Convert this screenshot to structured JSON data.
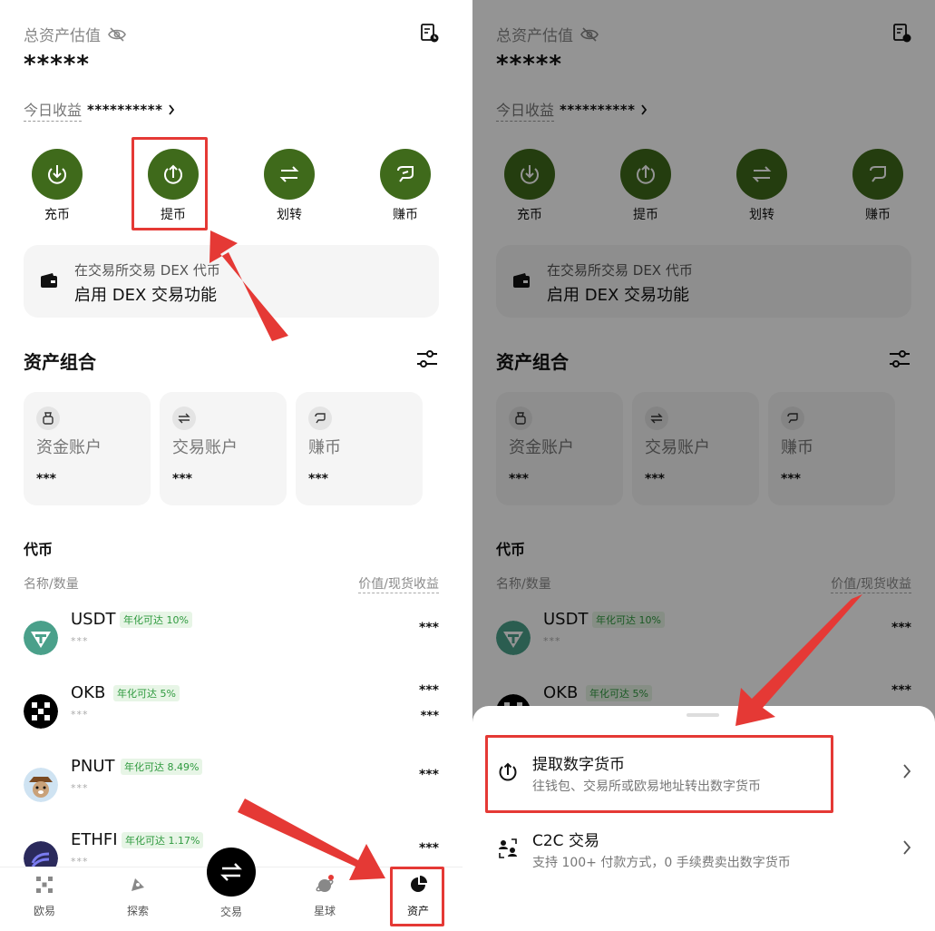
{
  "header": {
    "title": "总资产估值",
    "masked_total": "*****",
    "today_label": "今日收益",
    "today_value": "**********"
  },
  "actions": [
    {
      "label": "充币",
      "icon": "deposit-icon"
    },
    {
      "label": "提币",
      "icon": "withdraw-icon"
    },
    {
      "label": "划转",
      "icon": "transfer-icon"
    },
    {
      "label": "赚币",
      "icon": "earn-icon"
    }
  ],
  "dex_banner": {
    "line1": "在交易所交易 DEX 代币",
    "line2": "启用 DEX 交易功能"
  },
  "portfolio": {
    "title": "资产组合",
    "cards": [
      {
        "name": "资金账户",
        "amount": "***",
        "icon": "bag-icon"
      },
      {
        "name": "交易账户",
        "amount": "***",
        "icon": "swap-icon"
      },
      {
        "name": "赚币",
        "amount": "***",
        "icon": "earn-icon"
      }
    ]
  },
  "tokens": {
    "title": "代币",
    "col_left": "名称/数量",
    "col_right": "价值/现货收益",
    "rows": [
      {
        "symbol": "USDT",
        "apy": "年化可达 10%",
        "sub": "***",
        "value": "***",
        "value2": "",
        "color": "#4aa08a"
      },
      {
        "symbol": "OKB",
        "apy": "年化可达 5%",
        "sub": "***",
        "value": "***",
        "value2": "***",
        "color": "#000000"
      },
      {
        "symbol": "PNUT",
        "apy": "年化可达 8.49%",
        "sub": "***",
        "value": "***",
        "value2": "",
        "color": "#c9a27a"
      },
      {
        "symbol": "ETHFI",
        "apy": "年化可达 1.17%",
        "sub": "***",
        "value": "***",
        "value2": "",
        "color": "#2b2a5c"
      }
    ]
  },
  "nav": {
    "items": [
      "欧易",
      "探索",
      "交易",
      "星球",
      "资产"
    ]
  },
  "sheet": {
    "options": [
      {
        "title": "提取数字货币",
        "desc": "往钱包、交易所或欧易地址转出数字货币"
      },
      {
        "title": "C2C 交易",
        "desc": "支持 100+ 付款方式，0 手续费卖出数字货币"
      }
    ]
  },
  "colors": {
    "accent_green": "#3f6a1b",
    "highlight_red": "#e53935",
    "apy_green": "#2f9a3f"
  }
}
